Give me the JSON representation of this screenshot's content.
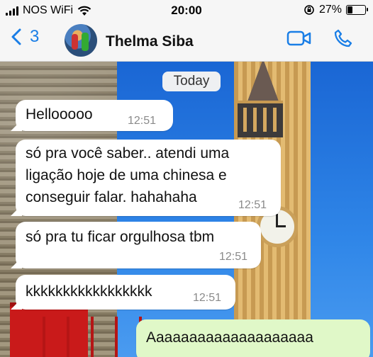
{
  "status_bar": {
    "carrier": "NOS WiFi",
    "time": "20:00",
    "battery": "27%"
  },
  "header": {
    "back_count": "3",
    "contact_name": "Thelma Siba"
  },
  "chat": {
    "date_label": "Today",
    "messages": [
      {
        "text": "Hellooooo",
        "time": "12:51"
      },
      {
        "line1": "só pra você saber.. atendi uma",
        "line2": "ligação hoje de uma chinesa e",
        "line3": "conseguir falar. hahahaha",
        "time": "12:51"
      },
      {
        "text": "só pra tu ficar orgulhosa tbm",
        "time": "12:51"
      },
      {
        "text": "kkkkkkkkkkkkkkkkk",
        "time": "12:51"
      }
    ],
    "outgoing": {
      "text": "Aaaaaaaaaaaaaaaaaaaa"
    }
  },
  "colors": {
    "accent": "#1a7ee6",
    "bubble_in": "#ffffff",
    "bubble_out": "#e0f8c8"
  },
  "icons": [
    "wifi-icon",
    "signal-icon",
    "orientation-lock-icon",
    "battery-icon",
    "chevron-left-icon",
    "video-call-icon",
    "phone-icon"
  ]
}
